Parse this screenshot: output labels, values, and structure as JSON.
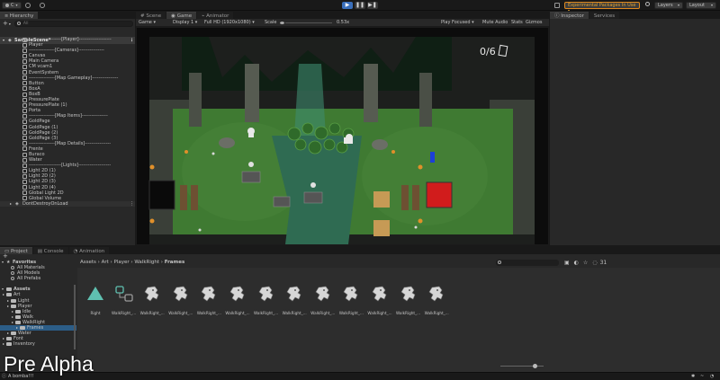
{
  "toolbar": {
    "account_label": "C",
    "experimental_label": "Experimental Packages In Use",
    "layers_label": "Layers",
    "layout_label": "Layout"
  },
  "hierarchy": {
    "tab_label": "Hierarchy",
    "search_placeholder": "All",
    "scene_name": "SampleScene*",
    "items": [
      {
        "label": "--------------------[Player]--------------------",
        "indent": 1
      },
      {
        "label": "Player",
        "indent": 1
      },
      {
        "label": "----------------[Cameras]----------------",
        "indent": 1
      },
      {
        "label": "Canvas",
        "indent": 1
      },
      {
        "label": "Main Camera",
        "indent": 1
      },
      {
        "label": "CM vcam1",
        "indent": 1
      },
      {
        "label": "EventSystem",
        "indent": 1
      },
      {
        "label": "----------------[Map Gameplay]----------------",
        "indent": 1
      },
      {
        "label": "Button",
        "indent": 1
      },
      {
        "label": "BoxA",
        "indent": 1
      },
      {
        "label": "BoxB",
        "indent": 1
      },
      {
        "label": "PressurePlate",
        "indent": 1
      },
      {
        "label": "PressurePlate (1)",
        "indent": 1
      },
      {
        "label": "Porta",
        "indent": 1
      },
      {
        "label": "----------------[Map Items]----------------",
        "indent": 1
      },
      {
        "label": "GoldPage",
        "indent": 1
      },
      {
        "label": "GoldPage (1)",
        "indent": 1
      },
      {
        "label": "GoldPage (2)",
        "indent": 1
      },
      {
        "label": "GoldPage (3)",
        "indent": 1
      },
      {
        "label": "----------------[Map Details]----------------",
        "indent": 1
      },
      {
        "label": "Frente",
        "indent": 1
      },
      {
        "label": "Buraco",
        "indent": 1
      },
      {
        "label": "Water",
        "indent": 1
      },
      {
        "label": "--------------------[Lights]--------------------",
        "indent": 1
      },
      {
        "label": "Light 2D (1)",
        "indent": 1
      },
      {
        "label": "Light 2D (2)",
        "indent": 1
      },
      {
        "label": "Light 2D (3)",
        "indent": 1
      },
      {
        "label": "Light 2D (4)",
        "indent": 1
      },
      {
        "label": "Global Light 2D",
        "indent": 1
      },
      {
        "label": "Global Volume",
        "indent": 1
      }
    ],
    "dont_destroy": "DontDestroyOnLoad"
  },
  "game_view": {
    "tabs": [
      "Scene",
      "Game",
      "Animator"
    ],
    "display_mode": "Game",
    "display": "Display 1",
    "resolution": "Full HD (1920x1080)",
    "scale_label": "Scale",
    "scale_value": "0.53x",
    "play_focused": "Play Focused",
    "mute_audio": "Mute Audio",
    "stats": "Stats",
    "gizmos": "Gizmos",
    "hud_counter": "0/6"
  },
  "inspector": {
    "tabs": [
      "Inspector",
      "Services"
    ]
  },
  "project": {
    "tabs": [
      "Project",
      "Console",
      "Animation"
    ],
    "favorites_label": "Favorites",
    "favorites": [
      "All Materials",
      "All Models",
      "All Prefabs"
    ],
    "assets_label": "Assets",
    "tree": [
      {
        "label": "Art",
        "indent": 1
      },
      {
        "label": "Light",
        "indent": 2
      },
      {
        "label": "Player",
        "indent": 2
      },
      {
        "label": "Idle",
        "indent": 3
      },
      {
        "label": "Walk",
        "indent": 3
      },
      {
        "label": "WalkRight",
        "indent": 3
      },
      {
        "label": "Frames",
        "indent": 4
      },
      {
        "label": "Water",
        "indent": 2
      },
      {
        "label": "Font",
        "indent": 1
      },
      {
        "label": "Inventory",
        "indent": 1
      }
    ],
    "breadcrumb": [
      "Assets",
      "Art",
      "Player",
      "WalkRight",
      "Frames"
    ],
    "item_count": "31",
    "assets": [
      {
        "label": "Right",
        "kind": "triangle"
      },
      {
        "label": "WalkRight_...",
        "kind": "controller"
      },
      {
        "label": "WalkRight_...",
        "kind": "frame"
      },
      {
        "label": "WalkRight_...",
        "kind": "frame"
      },
      {
        "label": "WalkRight_...",
        "kind": "frame"
      },
      {
        "label": "WalkRight_...",
        "kind": "frame"
      },
      {
        "label": "WalkRight_...",
        "kind": "frame"
      },
      {
        "label": "WalkRight_...",
        "kind": "frame"
      },
      {
        "label": "WalkRight_...",
        "kind": "frame"
      },
      {
        "label": "WalkRight_...",
        "kind": "frame"
      },
      {
        "label": "WalkRight_...",
        "kind": "frame"
      },
      {
        "label": "WalkRight_...",
        "kind": "frame"
      },
      {
        "label": "WalkRight_...",
        "kind": "frame"
      }
    ]
  },
  "overlay": {
    "pre_alpha": "Pre Alpha"
  },
  "statusbar": {
    "message": "A bomba!!!"
  },
  "colors": {
    "accent_blue": "#3a6fbb",
    "experimental_orange": "#e08a1e",
    "grass": "#3f7a32",
    "water": "#2f6b52",
    "red_block": "#d11c1c",
    "blue_gem": "#1c3fd8",
    "pressure_plate": "#c69a55"
  }
}
